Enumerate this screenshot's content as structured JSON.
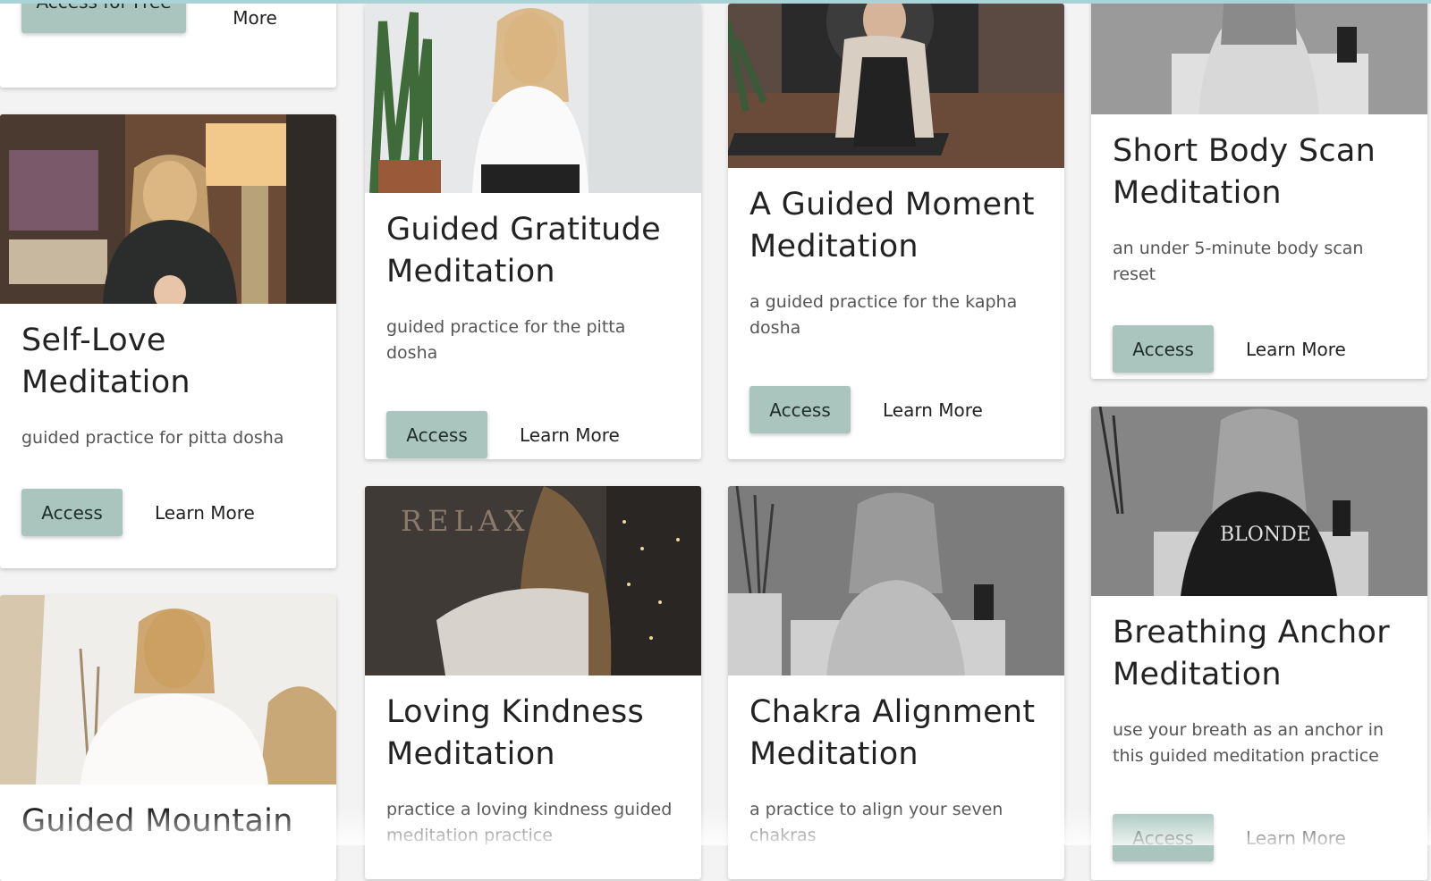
{
  "cards": {
    "c1": {
      "access_label": "Access for Free",
      "learn_label": "Learn More"
    },
    "self_love": {
      "title": "Self-Love Meditation",
      "description": "guided practice for pitta dosha",
      "access_label": "Access",
      "learn_label": "Learn More"
    },
    "mountain": {
      "title": "Guided Mountain"
    },
    "gratitude": {
      "title": "Guided Gratitude Meditation",
      "description": "guided practice for the pitta dosha",
      "access_label": "Access",
      "learn_label": "Learn More"
    },
    "loving": {
      "title": "Loving Kindness Meditation",
      "description": "practice a loving kindness guided meditation practice",
      "photo_text": "RELAX"
    },
    "moment": {
      "title": "A Guided Moment Meditation",
      "description": "a guided practice for the kapha dosha",
      "access_label": "Access",
      "learn_label": "Learn More"
    },
    "chakra": {
      "title": "Chakra Alignment Meditation",
      "description": "a practice to align your seven chakras"
    },
    "body_scan": {
      "title": "Short Body Scan Meditation",
      "description": "an under 5-minute body scan reset",
      "access_label": "Access",
      "learn_label": "Learn More"
    },
    "breathing": {
      "title": "Breathing Anchor Meditation",
      "description": "use your breath as an anchor in this guided meditation practice",
      "access_label": "Access",
      "learn_label": "Learn More",
      "photo_text": "BLONDE"
    }
  },
  "colors": {
    "accent_button": "#a9c5bd",
    "top_border": "#a9d3d6",
    "background": "#f3f3f3"
  }
}
